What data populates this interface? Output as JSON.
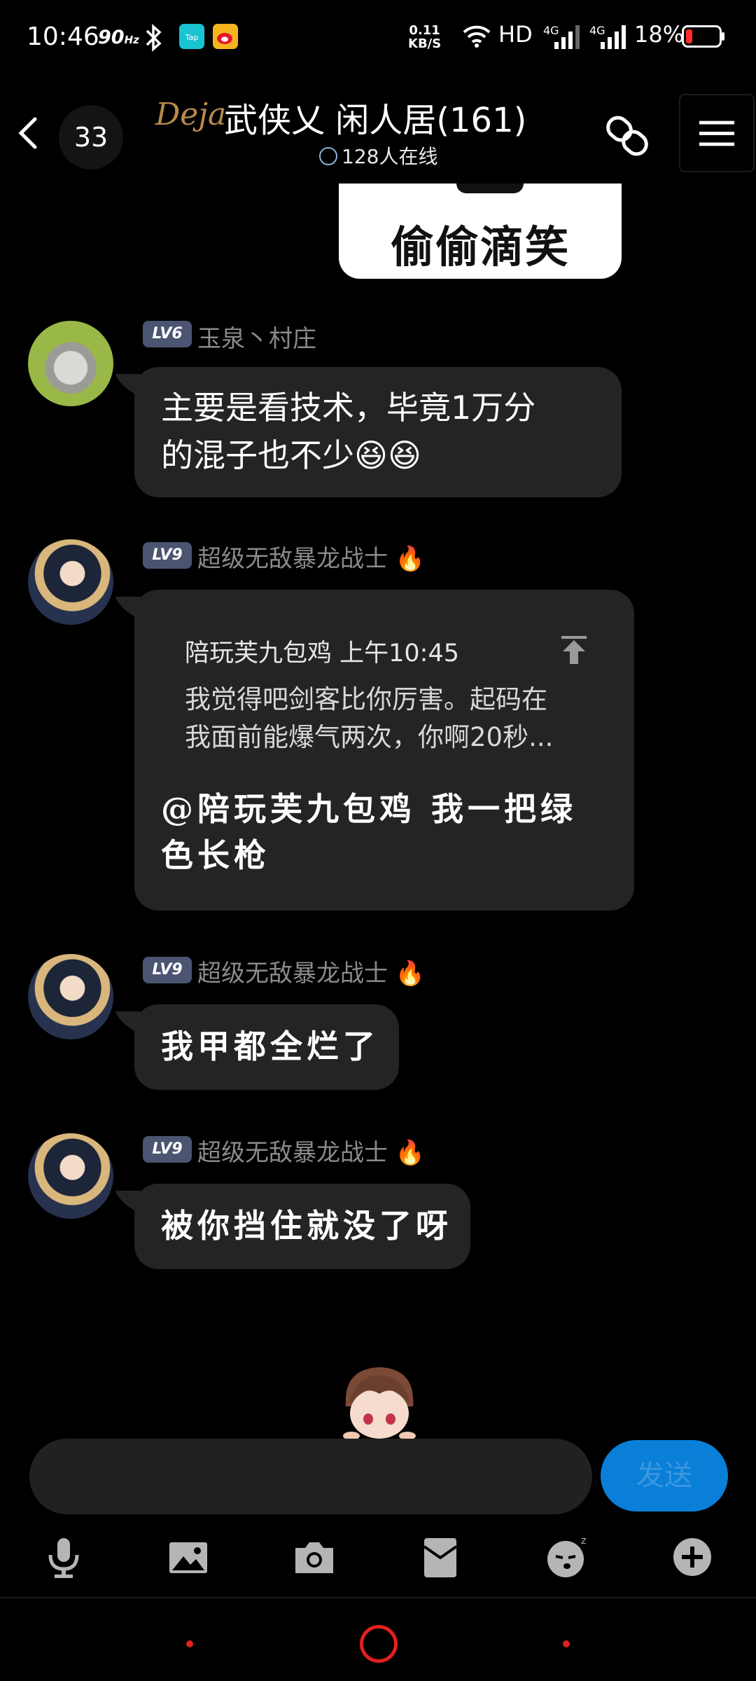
{
  "status_bar": {
    "time": "10:46",
    "refresh_rate": "90",
    "refresh_unit": "Hz",
    "net_speed_value": "0.11",
    "net_speed_unit": "KB/S",
    "hd_label": "HD",
    "net_type_1": "4G",
    "net_type_2": "4G",
    "battery_percent": "18%",
    "battery_level": 0.18
  },
  "header": {
    "unread_count": "33",
    "logo_text": "Deja",
    "group_title": "武侠乂 闲人居(161)",
    "online_text": "128人在线"
  },
  "sticker": {
    "text": "偷偷滴笑"
  },
  "messages": [
    {
      "level": "LV6",
      "sender": "玉泉丶村庄",
      "text_line1": "主要是看技术，毕竟1万分",
      "text_line2": "的混子也不少",
      "emoji": "😆😆",
      "avatar": "cat-avatar"
    },
    {
      "level": "LV9",
      "sender": "超级无敌暴龙战士",
      "fire": "🔥",
      "quote": {
        "name_time": "陪玩芙九包鸡 上午10:45",
        "line1": "我觉得吧剑客比你厉害。起码在",
        "line2": "我面前能爆气两次，你啊20秒..."
      },
      "reply_line1": "@陪玩芙九包鸡 我一把绿",
      "reply_line2": "色长枪"
    },
    {
      "level": "LV9",
      "sender": "超级无敌暴龙战士",
      "fire": "🔥",
      "text": "我甲都全烂了"
    },
    {
      "level": "LV9",
      "sender": "超级无敌暴龙战士",
      "fire": "🔥",
      "text": "被你挡住就没了呀"
    }
  ],
  "composer": {
    "input_value": "",
    "send_label": "发送"
  },
  "toolbar_icons": [
    "microphone-icon",
    "image-icon",
    "camera-icon",
    "red-packet-icon",
    "emoji-icon",
    "plus-icon"
  ],
  "colors": {
    "background": "#000000",
    "bubble": "#242424",
    "send_button": "#0a7fd8",
    "level_badge": "#4b5470",
    "accent_red": "#e02020"
  }
}
